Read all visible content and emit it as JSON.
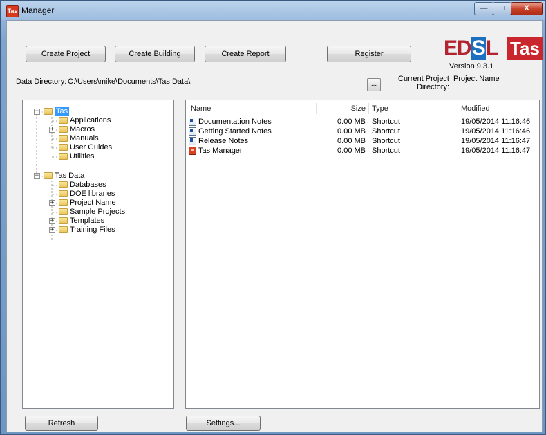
{
  "window": {
    "title": "Manager",
    "app_icon_text": "Tas",
    "controls": {
      "minimize": "—",
      "maximize": "□",
      "close": "X"
    }
  },
  "toolbar": {
    "create_project": "Create Project",
    "create_building": "Create Building",
    "create_report": "Create Report",
    "register": "Register"
  },
  "logo": {
    "edsl_pre": "ED",
    "edsl_s": "S",
    "edsl_post": "L",
    "tas": "Tas",
    "version": "Version 9.3.1"
  },
  "data_directory": {
    "label": "Data Directory:",
    "value": "C:\\Users\\mike\\Documents\\Tas Data\\",
    "browse": "..."
  },
  "current_project": {
    "label_line1": "Current Project",
    "label_line2": "Directory:",
    "value": "Project Name"
  },
  "tree": [
    {
      "label": "Tas",
      "expander": "−",
      "selected": true
    },
    {
      "label": "Applications"
    },
    {
      "label": "Macros",
      "expander": "+"
    },
    {
      "label": "Manuals"
    },
    {
      "label": "User Guides"
    },
    {
      "label": "Utilities"
    },
    {
      "label": "Tas Data",
      "expander": "−"
    },
    {
      "label": "Databases"
    },
    {
      "label": "DOE libraries"
    },
    {
      "label": "Project Name",
      "expander": "+"
    },
    {
      "label": "Sample Projects"
    },
    {
      "label": "Templates",
      "expander": "+"
    },
    {
      "label": "Training Files",
      "expander": "+"
    }
  ],
  "file_list": {
    "columns": {
      "name": "Name",
      "size": "Size",
      "type": "Type",
      "modified": "Modified"
    },
    "rows": [
      {
        "icon": "document-shortcut-icon",
        "name": "Documentation Notes",
        "size": "0.00 MB",
        "type": "Shortcut",
        "modified": "19/05/2014 11:16:46"
      },
      {
        "icon": "document-shortcut-icon",
        "name": "Getting Started Notes",
        "size": "0.00 MB",
        "type": "Shortcut",
        "modified": "19/05/2014 11:16:46"
      },
      {
        "icon": "document-shortcut-icon",
        "name": "Release Notes",
        "size": "0.00 MB",
        "type": "Shortcut",
        "modified": "19/05/2014 11:16:47"
      },
      {
        "icon": "tas-manager-icon",
        "name": "Tas Manager",
        "size": "0.00 MB",
        "type": "Shortcut",
        "modified": "19/05/2014 11:16:47"
      }
    ]
  },
  "bottom": {
    "refresh": "Refresh",
    "settings": "Settings..."
  },
  "colors": {
    "selection": "#3399ff",
    "edsl_red": "#b32430",
    "edsl_blue": "#1d6fbf",
    "tas_red": "#c9262e"
  }
}
